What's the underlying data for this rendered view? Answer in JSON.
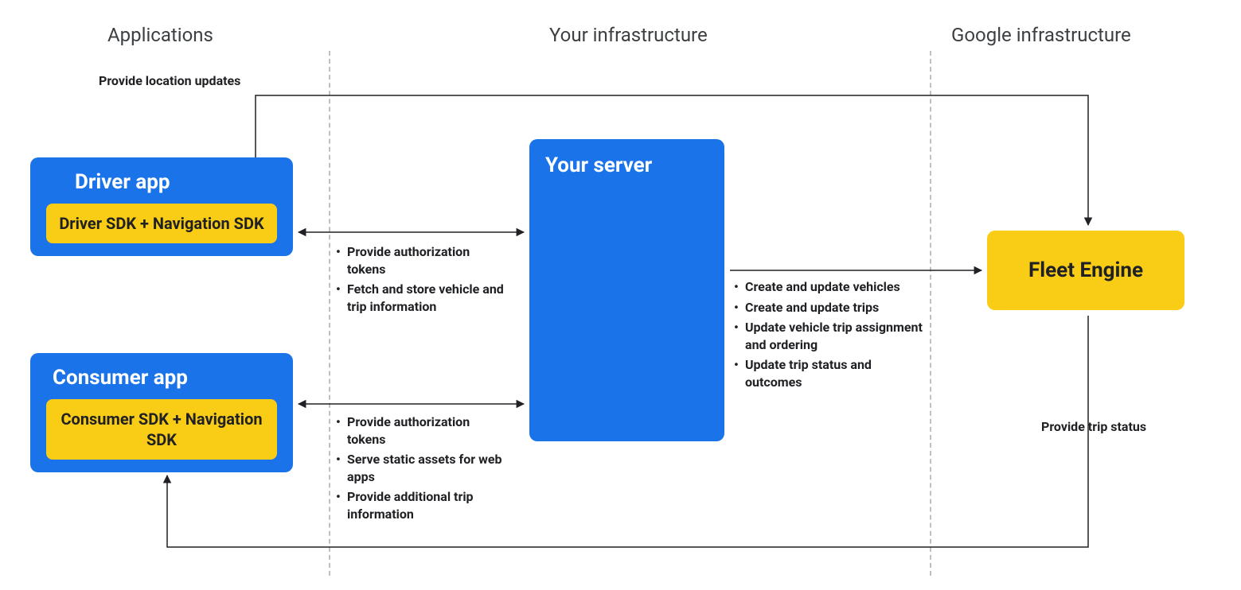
{
  "sections": {
    "applications": "Applications",
    "your_infra": "Your infrastructure",
    "google_infra": "Google infrastructure"
  },
  "driver_app": {
    "title": "Driver app",
    "sdk": "Driver SDK + Navigation SDK"
  },
  "consumer_app": {
    "title": "Consumer app",
    "sdk": "Consumer SDK + Navigation SDK"
  },
  "server": {
    "title": "Your server"
  },
  "fleet_engine": {
    "title": "Fleet Engine"
  },
  "labels": {
    "location_updates": "Provide location updates",
    "trip_status": "Provide trip status"
  },
  "driver_bullets": {
    "b1": "Provide authorization tokens",
    "b2": "Fetch and store vehicle and trip information"
  },
  "consumer_bullets": {
    "b1": "Provide authorization tokens",
    "b2": "Serve static assets for web apps",
    "b3": "Provide additional trip information"
  },
  "server_bullets": {
    "b1": "Create and update vehicles",
    "b2": "Create and update trips",
    "b3": "Update vehicle trip assignment and ordering",
    "b4": "Update trip status and outcomes"
  }
}
